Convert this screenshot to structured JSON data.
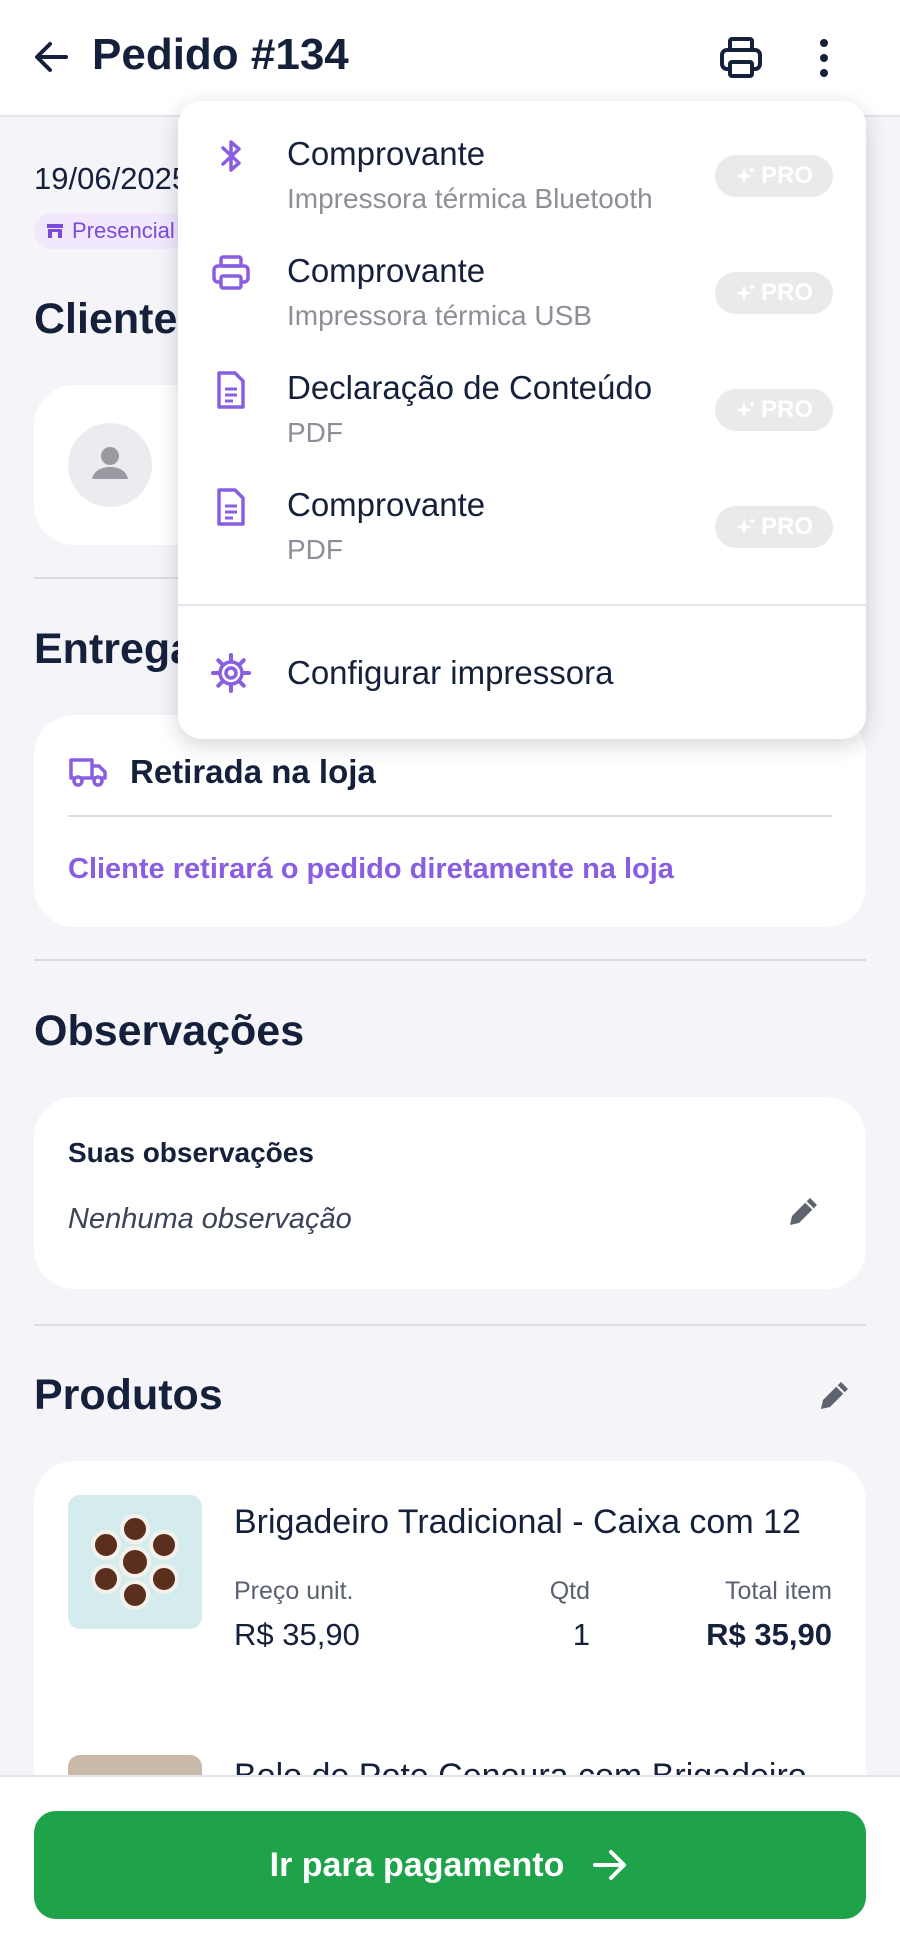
{
  "header": {
    "title": "Pedido #134"
  },
  "order": {
    "date": "19/06/2025",
    "channel": "Presencial"
  },
  "sections": {
    "client": "Cliente",
    "delivery": "Entrega",
    "observations": "Observações",
    "products": "Produtos"
  },
  "delivery": {
    "title": "Retirada na loja",
    "description": "Cliente retirará o pedido diretamente na loja"
  },
  "observations": {
    "label": "Suas observações",
    "value": "Nenhuma observação"
  },
  "products": {
    "columns": {
      "unit_price": "Preço unit.",
      "qty": "Qtd",
      "total": "Total item"
    },
    "items": [
      {
        "name": "Brigadeiro Tradicional - Caixa com 12",
        "unit_price": "R$ 35,90",
        "qty": "1",
        "total": "R$ 35,90"
      },
      {
        "name": "Bolo de Pote Cenoura com Brigadeiro"
      }
    ]
  },
  "footer": {
    "pay_button": "Ir para pagamento"
  },
  "print_menu": {
    "items": [
      {
        "icon": "bluetooth-icon",
        "title": "Comprovante",
        "subtitle": "Impressora térmica Bluetooth",
        "badge": "PRO"
      },
      {
        "icon": "printer-icon",
        "title": "Comprovante",
        "subtitle": "Impressora térmica USB",
        "badge": "PRO"
      },
      {
        "icon": "document-icon",
        "title": "Declaração de Conteúdo",
        "subtitle": "PDF",
        "badge": "PRO"
      },
      {
        "icon": "document-icon",
        "title": "Comprovante",
        "subtitle": "PDF",
        "badge": "PRO"
      }
    ],
    "config": "Configurar impressora"
  },
  "colors": {
    "accent": "#8a5ee0",
    "primary_text": "#15213b",
    "pay_green": "#1ea34b",
    "badge_bg": "#eaeaea"
  }
}
